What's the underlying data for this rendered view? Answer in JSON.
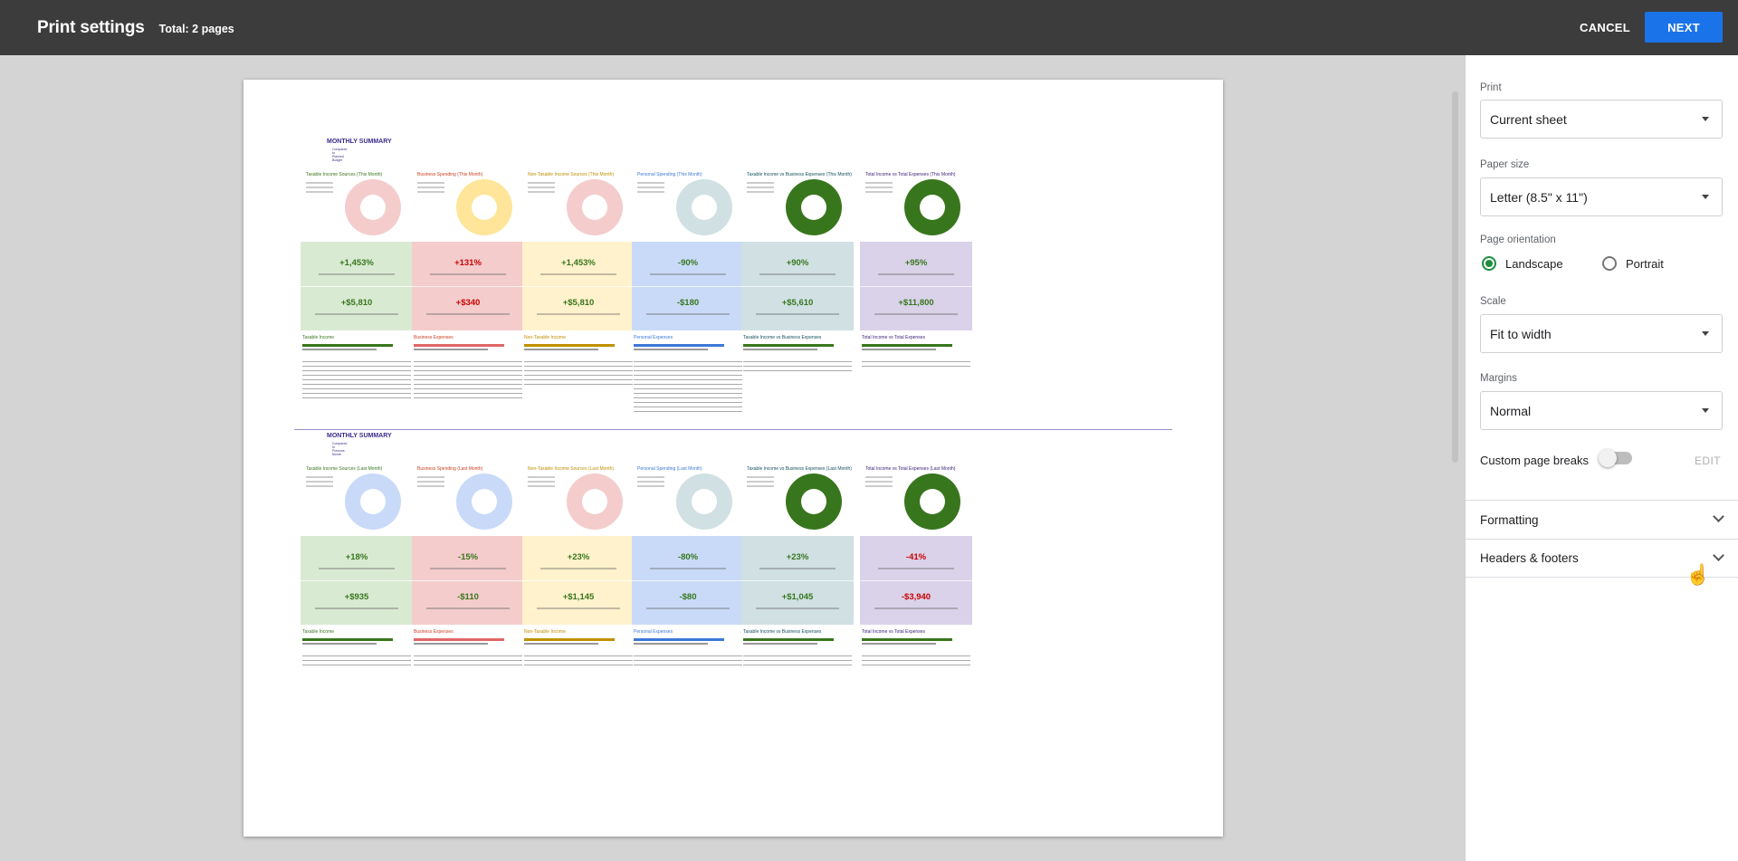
{
  "header": {
    "title": "Print settings",
    "total": "Total: 2 pages",
    "cancel_label": "CANCEL",
    "next_label": "NEXT"
  },
  "panel": {
    "print_label": "Print",
    "print_value": "Current sheet",
    "paper_label": "Paper size",
    "paper_value": "Letter (8.5\" x 11\")",
    "orientation_label": "Page orientation",
    "orientation_options": [
      "Landscape",
      "Portrait"
    ],
    "orientation_selected": "Landscape",
    "scale_label": "Scale",
    "scale_value": "Fit to width",
    "margins_label": "Margins",
    "margins_value": "Normal",
    "page_breaks_label": "Custom page breaks",
    "page_breaks_on": false,
    "edit_label": "EDIT",
    "formatting_label": "Formatting",
    "headers_label": "Headers & footers"
  },
  "preview": {
    "page1": {
      "title": "MONTHLY SUMMARY",
      "subtitle": "Compared to Planned Budget",
      "columns": [
        {
          "title": "Taxable Income Sources (This Month)",
          "color": "#d9ead3",
          "donut": "#f4cccc",
          "top": "+1,453%",
          "bottom": "+$5,810",
          "top_color": "#38761d",
          "bottom_color": "#38761d",
          "bar_title": "Taxable Income",
          "bar_color": "#38761d",
          "title_color": "#38761d"
        },
        {
          "title": "Business Spending (This Month)",
          "color": "#f4cccc",
          "donut": "#ffe599",
          "top": "+131%",
          "bottom": "+$340",
          "top_color": "#cc0000",
          "bottom_color": "#cc0000",
          "bar_title": "Business Expenses",
          "bar_color": "#e06666",
          "title_color": "#cc4125"
        },
        {
          "title": "Non-Taxable Income Sources (This Month)",
          "color": "#fff2cc",
          "donut": "#f4cccc",
          "top": "+1,453%",
          "bottom": "+$5,810",
          "top_color": "#38761d",
          "bottom_color": "#38761d",
          "bar_title": "Non-Taxable Income",
          "bar_color": "#bf9000",
          "title_color": "#bf9000"
        },
        {
          "title": "Personal Spending (This Month)",
          "color": "#c9daf8",
          "donut": "#d0e0e3",
          "top": "-90%",
          "bottom": "-$180",
          "top_color": "#38761d",
          "bottom_color": "#38761d",
          "bar_title": "Personal Expenses",
          "bar_color": "#3c78d8",
          "title_color": "#3c78d8"
        },
        {
          "title": "Taxable Income vs Business Expenses (This Month)",
          "color": "#d0e0e3",
          "donut": "#38761d",
          "top": "+90%",
          "bottom": "+$5,610",
          "top_color": "#38761d",
          "bottom_color": "#38761d",
          "bar_title": "Taxable Income vs Business Expenses",
          "bar_color": "#38761d",
          "title_color": "#134f5c"
        },
        {
          "title": "Total Income vs Total Expenses (This Month)",
          "color": "#d9d2e9",
          "donut": "#38761d",
          "top": "+95%",
          "bottom": "+$11,800",
          "top_color": "#38761d",
          "bottom_color": "#38761d",
          "bar_title": "Total Income vs Total Expenses",
          "bar_color": "#38761d",
          "title_color": "#351c75"
        }
      ]
    },
    "page2": {
      "title": "MONTHLY SUMMARY",
      "subtitle": "Compared to Previous Month",
      "columns": [
        {
          "title": "Taxable Income Sources (Last Month)",
          "color": "#d9ead3",
          "donut": "#c9daf8",
          "top": "+18%",
          "bottom": "+$935",
          "top_color": "#38761d",
          "bottom_color": "#38761d",
          "bar_title": "Taxable Income",
          "bar_color": "#38761d",
          "title_color": "#38761d"
        },
        {
          "title": "Business Spending (Last Month)",
          "color": "#f4cccc",
          "donut": "#c9daf8",
          "top": "-15%",
          "bottom": "-$110",
          "top_color": "#38761d",
          "bottom_color": "#38761d",
          "bar_title": "Business Expenses",
          "bar_color": "#e06666",
          "title_color": "#cc4125"
        },
        {
          "title": "Non-Taxable Income Sources (Last Month)",
          "color": "#fff2cc",
          "donut": "#f4cccc",
          "top": "+23%",
          "bottom": "+$1,145",
          "top_color": "#38761d",
          "bottom_color": "#38761d",
          "bar_title": "Non-Taxable Income",
          "bar_color": "#bf9000",
          "title_color": "#bf9000"
        },
        {
          "title": "Personal Spending (Last Month)",
          "color": "#c9daf8",
          "donut": "#d0e0e3",
          "top": "-80%",
          "bottom": "-$80",
          "top_color": "#38761d",
          "bottom_color": "#38761d",
          "bar_title": "Personal Expenses",
          "bar_color": "#3c78d8",
          "title_color": "#3c78d8"
        },
        {
          "title": "Taxable Income vs Business Expenses (Last Month)",
          "color": "#d0e0e3",
          "donut": "#38761d",
          "top": "+23%",
          "bottom": "+$1,045",
          "top_color": "#38761d",
          "bottom_color": "#38761d",
          "bar_title": "Taxable Income vs Business Expenses",
          "bar_color": "#38761d",
          "title_color": "#134f5c"
        },
        {
          "title": "Total Income vs Total Expenses (Last Month)",
          "color": "#d9d2e9",
          "donut": "#38761d",
          "top": "-41%",
          "bottom": "-$3,940",
          "top_color": "#cc0000",
          "bottom_color": "#cc0000",
          "bar_title": "Total Income vs Total Expenses",
          "bar_color": "#38761d",
          "title_color": "#351c75"
        }
      ]
    }
  }
}
